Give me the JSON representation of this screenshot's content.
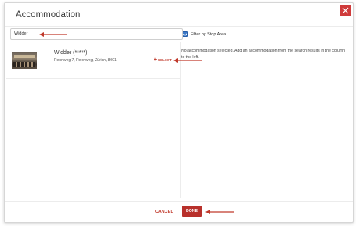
{
  "dialog": {
    "title": "Accommodation",
    "close_icon": "close-icon",
    "accent_color": "#cf3b3b"
  },
  "search": {
    "value": "Widder"
  },
  "filter": {
    "label": "Filter by Stop Area",
    "checked": true
  },
  "results": [
    {
      "name": "Widder (*****)",
      "address": "Rennweg 7, Rennweg, Zürich, 8001",
      "select_label": "SELECT",
      "select_icon": "plus-icon"
    }
  ],
  "info_text": "No accommodation selected. Add an accommodation from the search results in the column to the left.",
  "footer": {
    "cancel_label": "CANCEL",
    "done_label": "DONE"
  }
}
